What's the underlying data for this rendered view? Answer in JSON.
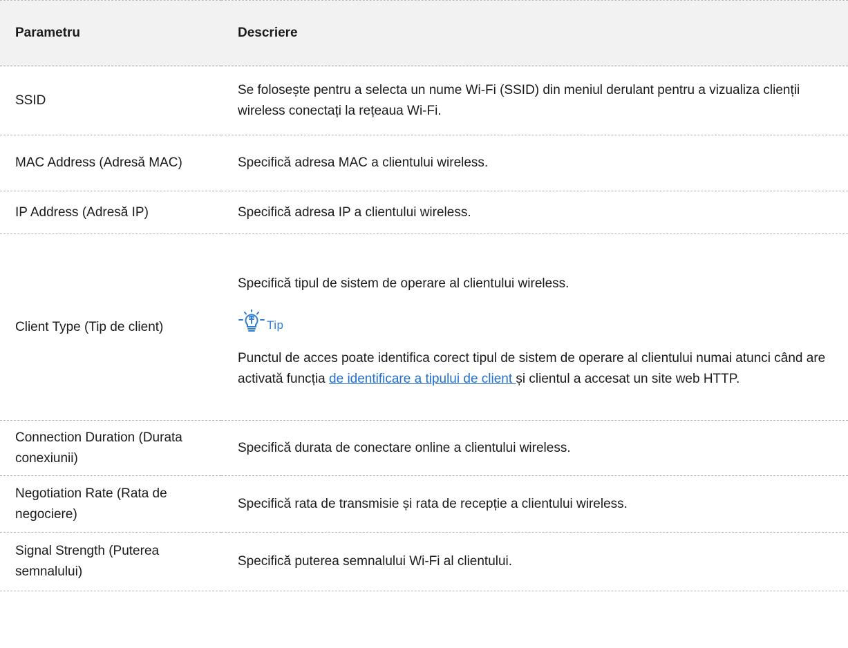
{
  "table": {
    "headers": {
      "parameter": "Parametru",
      "description": "Descriere"
    },
    "rows": [
      {
        "parameter": "SSID",
        "description": "Se folosește pentru a selecta un nume Wi-Fi (SSID) din meniul derulant pentru a vizualiza clienții wireless conectați la rețeaua Wi-Fi."
      },
      {
        "parameter": "MAC Address (Adresă MAC)",
        "description": "Specifică adresa MAC a clientului wireless."
      },
      {
        "parameter": "IP Address (Adresă IP)",
        "description": "Specifică adresa IP a clientului wireless."
      },
      {
        "parameter": "Client Type (Tip de client)",
        "description": "Specifică tipul de sistem de operare al clientului wireless.",
        "tip": {
          "icon": "lightbulb-icon",
          "label": "Tip",
          "text_before": "Punctul de acces poate identifica corect tipul de sistem de operare al clientului numai atunci când are activată funcția ",
          "link_text": "de identificare a tipului de client ",
          "text_after": "și clientul a accesat un site web HTTP."
        }
      },
      {
        "parameter": "Connection Duration (Durata conexiunii)",
        "description": "Specifică durata de conectare online a clientului wireless."
      },
      {
        "parameter": "Negotiation Rate (Rata de negociere)",
        "description": "Specifică rata de transmisie și rata de recepție a clientului wireless."
      },
      {
        "parameter": "Signal Strength (Puterea semnalului)",
        "description": "Specifică puterea semnalului Wi-Fi al clientului."
      }
    ]
  },
  "colors": {
    "header_background": "#f2f2f2",
    "tip_accent": "#2e7ed6",
    "link": "#1f6fd1",
    "row_divider": "#b3b3b3"
  }
}
